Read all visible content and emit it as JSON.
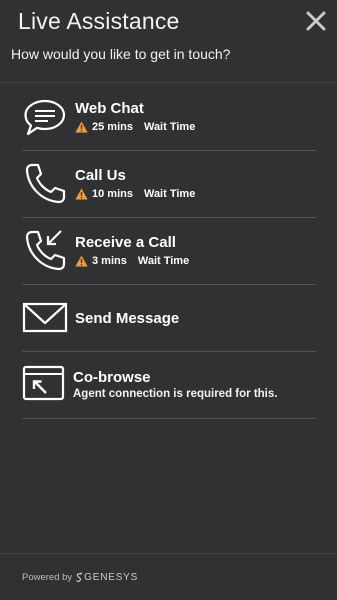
{
  "header": {
    "title": "Live Assistance",
    "subtitle": "How would you like to get in touch?"
  },
  "options": [
    {
      "title": "Web Chat",
      "wait_time": "25 mins",
      "wait_label": "Wait Time",
      "icon": "chat-bubble-icon"
    },
    {
      "title": "Call Us",
      "wait_time": "10 mins",
      "wait_label": "Wait Time",
      "icon": "phone-icon"
    },
    {
      "title": "Receive a Call",
      "wait_time": "3 mins",
      "wait_label": "Wait Time",
      "icon": "incoming-call-icon"
    },
    {
      "title": "Send Message",
      "icon": "envelope-icon"
    },
    {
      "title": "Co-browse",
      "description": "Agent connection is required for this.",
      "icon": "cobrowse-icon"
    }
  ],
  "footer": {
    "powered_by": "Powered by",
    "brand": "GENESYS"
  },
  "colors": {
    "background": "#2f3133",
    "warning": "#f0a033",
    "divider": "#515456"
  }
}
